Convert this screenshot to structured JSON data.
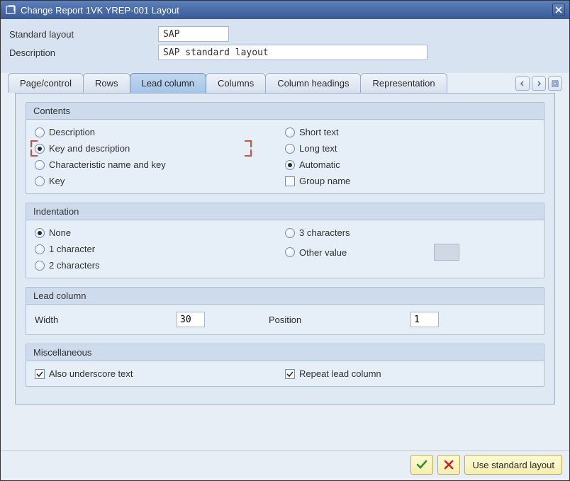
{
  "window": {
    "title": "Change Report 1VK YREP-001 Layout"
  },
  "header": {
    "standard_layout_label": "Standard layout",
    "standard_layout_value": "SAP",
    "description_label": "Description",
    "description_value": "SAP standard layout"
  },
  "tabs": {
    "page_control": "Page/control",
    "rows": "Rows",
    "lead_column": "Lead column",
    "columns": "Columns",
    "column_headings": "Column headings",
    "representation": "Representation"
  },
  "groups": {
    "contents": {
      "title": "Contents",
      "left": {
        "description": "Description",
        "key_and_description": "Key and description",
        "char_name_key": "Characteristic name and key",
        "key": "Key"
      },
      "right": {
        "short_text": "Short text",
        "long_text": "Long text",
        "automatic": "Automatic",
        "group_name": "Group name"
      }
    },
    "indentation": {
      "title": "Indentation",
      "left": {
        "none": "None",
        "one_char": "1 character",
        "two_chars": "2 characters"
      },
      "right": {
        "three_chars": "3 characters",
        "other_value": "Other value"
      }
    },
    "leadcol": {
      "title": "Lead column",
      "width_label": "Width",
      "width_value": "30",
      "position_label": "Position",
      "position_value": "1"
    },
    "misc": {
      "title": "Miscellaneous",
      "also_underscore": "Also underscore text",
      "repeat_lead": "Repeat lead column"
    }
  },
  "footer": {
    "use_standard": "Use standard layout"
  }
}
